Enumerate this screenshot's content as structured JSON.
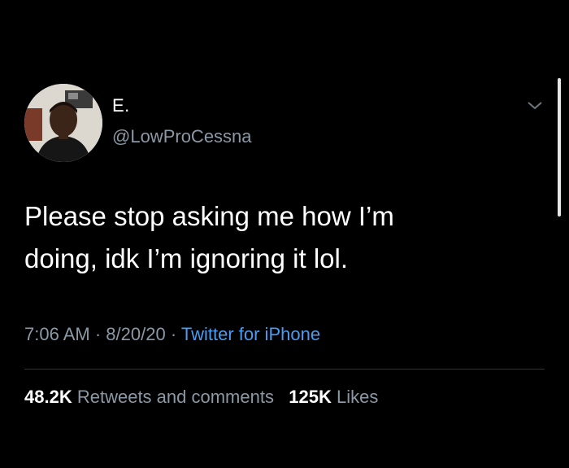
{
  "user": {
    "display_name": "E.",
    "handle": "@LowProCessna"
  },
  "tweet": {
    "text": "Please stop asking me how I’m\ndoing, idk I’m ignoring it lol.",
    "time": "7:06 AM",
    "separator": "·",
    "date": "8/20/20",
    "source": "Twitter for iPhone"
  },
  "stats": {
    "retweets_count": "48.2K",
    "retweets_label": "Retweets and comments",
    "likes_count": "125K",
    "likes_label": "Likes"
  },
  "icons": {
    "menu": "chevron-down-icon"
  },
  "colors": {
    "background": "#000000",
    "text": "#ffffff",
    "secondary": "#8b98a5",
    "link": "#4a9cf0"
  }
}
